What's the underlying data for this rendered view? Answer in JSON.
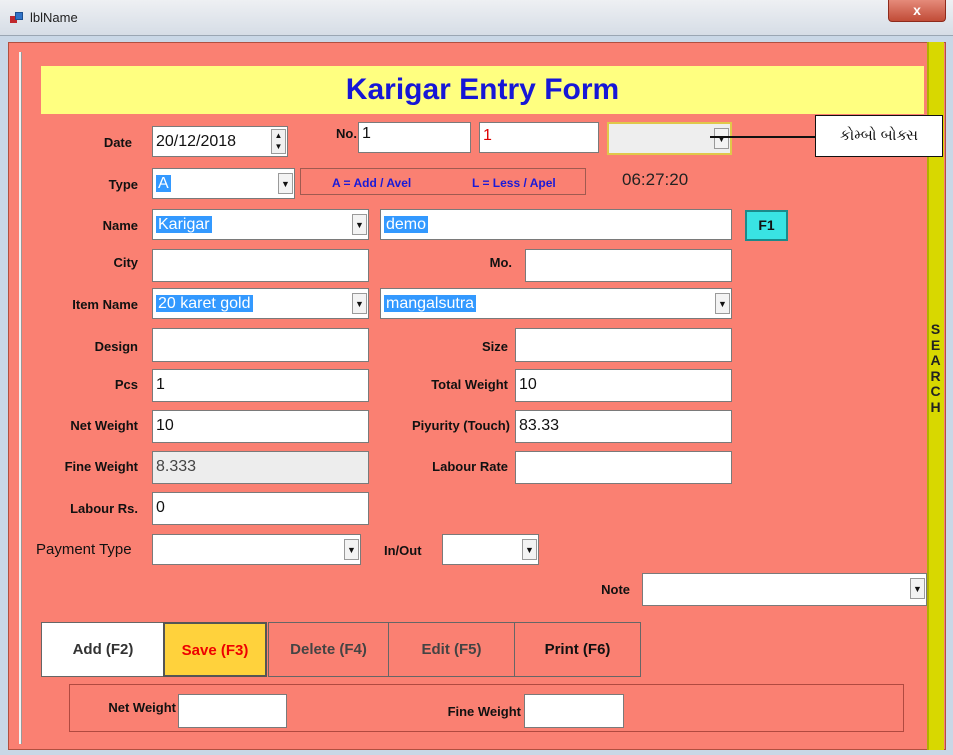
{
  "window": {
    "title": "lblName",
    "close_glyph": "x"
  },
  "form": {
    "heading": "Karigar Entry Form"
  },
  "fields": {
    "date": {
      "label": "Date",
      "value": "20/12/2018"
    },
    "no": {
      "label": "No.",
      "value1": "1",
      "value2": "1",
      "value3": ""
    },
    "type": {
      "label": "Type",
      "value": "A"
    },
    "legend_add": "A = Add / Avel",
    "legend_less": "L = Less / Apel",
    "time": "06:27:20",
    "name": {
      "label": "Name",
      "value": "Karigar",
      "value2": "demo"
    },
    "f1_label": "F1",
    "city": {
      "label": "City",
      "value": ""
    },
    "mo": {
      "label": "Mo.",
      "value": ""
    },
    "item_name": {
      "label": "Item Name",
      "value": "20 karet gold",
      "value2": "mangalsutra"
    },
    "design": {
      "label": "Design",
      "value": ""
    },
    "size": {
      "label": "Size",
      "value": ""
    },
    "pcs": {
      "label": "Pcs",
      "value": "1"
    },
    "total_weight": {
      "label": "Total Weight",
      "value": "10"
    },
    "net_weight": {
      "label": "Net Weight",
      "value": "10"
    },
    "piyurity": {
      "label": "Piyurity (Touch)",
      "value": "83.33"
    },
    "fine_weight": {
      "label": "Fine Weight",
      "value": "8.333"
    },
    "labour_rate": {
      "label": "Labour Rate",
      "value": ""
    },
    "labour_rs": {
      "label": "Labour  Rs.",
      "value": "0"
    },
    "payment_type": {
      "label": "Payment Type",
      "value": ""
    },
    "in_out": {
      "label": "In/Out",
      "value": ""
    },
    "note": {
      "label": "Note",
      "value": ""
    }
  },
  "callout": {
    "text": "કોમ્બો બોક્સ"
  },
  "search_label": "SEARCH",
  "search_letters": [
    "S",
    "E",
    "A",
    "R",
    "C",
    "H"
  ],
  "buttons": {
    "add": "Add (F2)",
    "save": "Save (F3)",
    "delete": "Delete (F4)",
    "edit": "Edit (F5)",
    "print": "Print (F6)"
  },
  "summary": {
    "net_weight_label": "Net Weight",
    "net_weight_value": "",
    "fine_weight_label": "Fine Weight",
    "fine_weight_value": ""
  },
  "icons": {
    "dropdown": "chevron-down-icon",
    "spinner": "spin-updown-icon",
    "app": "app-window-icon"
  },
  "colors": {
    "form_bg": "#fa8072",
    "heading_bg": "#ffff80",
    "heading_text": "#1717d6",
    "search_strip": "#d8d800",
    "save_bg": "#ffd23c",
    "f1_bg": "#39e3e3"
  }
}
